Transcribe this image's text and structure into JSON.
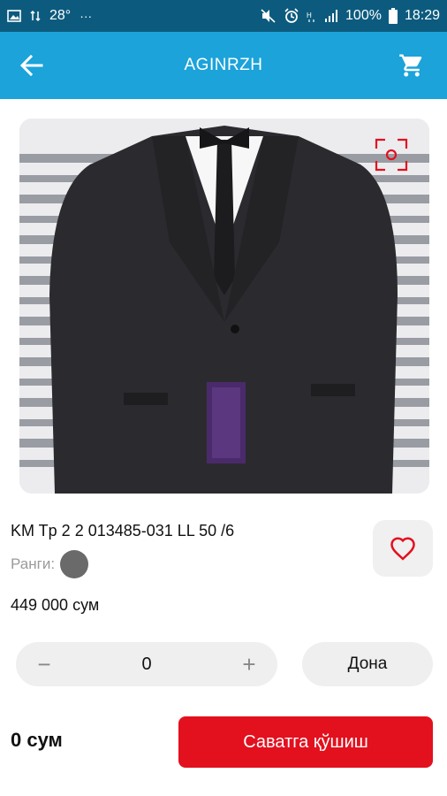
{
  "status_bar": {
    "temperature": "28°",
    "more": "···",
    "battery": "100%",
    "time": "18:29"
  },
  "app_bar": {
    "title": "AGINRZH"
  },
  "product": {
    "name": "KM Tp 2 2 013485-031 LL 50 /6",
    "color_label": "Ранги:",
    "color_value": "#6a6a6a",
    "price": "449 000 сум"
  },
  "quantity": {
    "minus": "−",
    "value": "0",
    "plus": "+",
    "unit": "Дона"
  },
  "footer": {
    "total": "0 сум",
    "add_to_cart": "Саватга қўшиш"
  },
  "colors": {
    "status_bar": "#0c5b7e",
    "app_bar": "#1ba3da",
    "accent_red": "#e3101e"
  }
}
